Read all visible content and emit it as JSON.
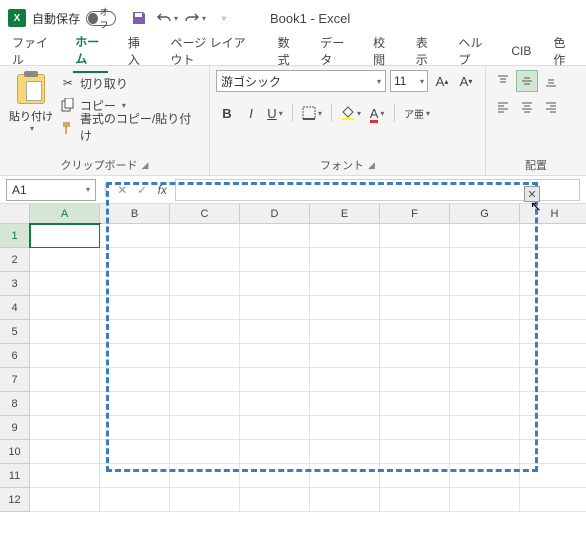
{
  "titlebar": {
    "autosave_label": "自動保存",
    "autosave_state": "オフ",
    "title": "Book1 - Excel"
  },
  "tabs": {
    "file": "ファイル",
    "home": "ホーム",
    "insert": "挿入",
    "pagelayout": "ページ レイアウト",
    "formulas": "数式",
    "data": "データ",
    "review": "校閲",
    "view": "表示",
    "help": "ヘルプ",
    "cib": "CIB",
    "color": "色作"
  },
  "clipboard": {
    "paste": "貼り付け",
    "cut": "切り取り",
    "copy": "コピー",
    "format_painter": "書式のコピー/貼り付け",
    "group_label": "クリップボード"
  },
  "font": {
    "name": "游ゴシック",
    "size": "11",
    "group_label": "フォント",
    "ruby": "ア亜"
  },
  "align": {
    "group_label": "配置"
  },
  "namebox": {
    "value": "A1"
  },
  "columns": [
    "A",
    "B",
    "C",
    "D",
    "E",
    "F",
    "G",
    "H"
  ],
  "rows": [
    "1",
    "2",
    "3",
    "4",
    "5",
    "6",
    "7",
    "8",
    "9",
    "10",
    "11",
    "12"
  ]
}
